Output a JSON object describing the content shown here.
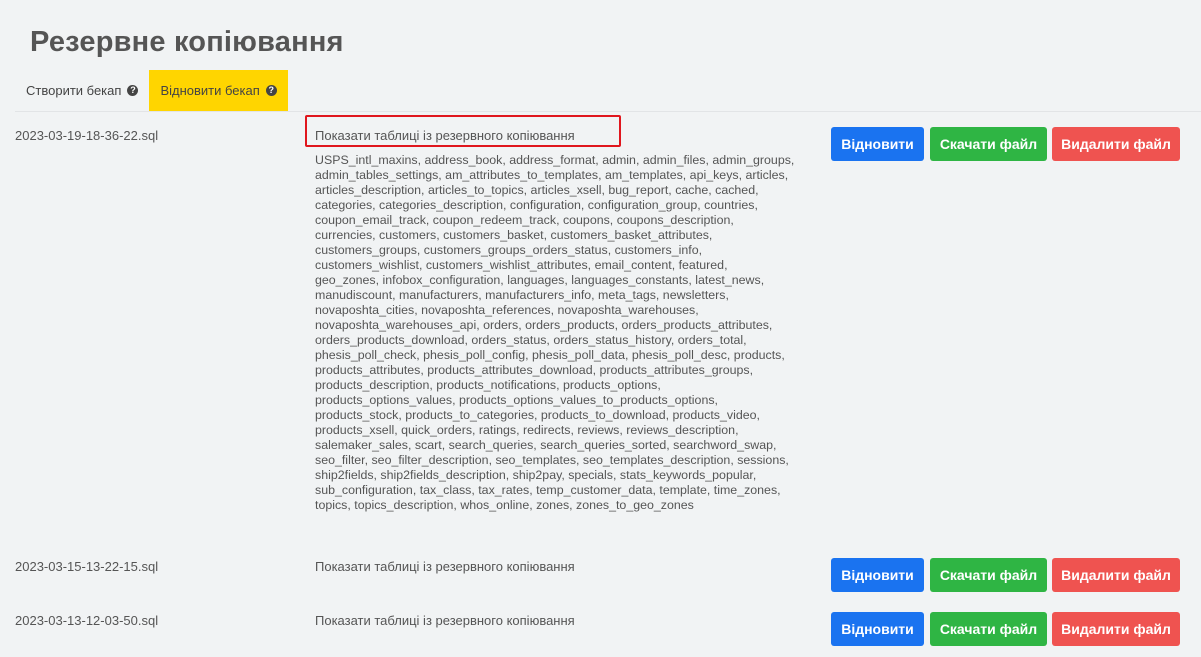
{
  "page": {
    "title": "Резервне копіювання"
  },
  "tabs": [
    {
      "label": "Створити бекап",
      "active": false,
      "icon": "question-circle-icon"
    },
    {
      "label": "Відновити бекап",
      "active": true,
      "icon": "question-circle-icon"
    }
  ],
  "colors": {
    "active_tab": "#ffd500",
    "restore": "#1a73f0",
    "download": "#2fb544",
    "delete": "#ef5350",
    "highlight": "#e0161d"
  },
  "actions": {
    "restore": "Відновити",
    "download": "Скачати файл",
    "delete": "Видалити файл"
  },
  "backups": [
    {
      "filename": "2023-03-19-18-36-22.sql",
      "show_tables": "Показати таблиці із резервного копіювання",
      "tables_expanded": true,
      "tables_text": "USPS_intl_maxins, address_book, address_format, admin, admin_files, admin_groups, admin_tables_settings, am_attributes_to_templates, am_templates, api_keys, articles, articles_description, articles_to_topics, articles_xsell, bug_report, cache, cached, categories, categories_description, configuration, configuration_group, countries, coupon_email_track, coupon_redeem_track, coupons, coupons_description, currencies, customers, customers_basket, customers_basket_attributes, customers_groups, customers_groups_orders_status, customers_info, customers_wishlist, customers_wishlist_attributes, email_content, featured, geo_zones, infobox_configuration, languages, languages_constants, latest_news, manudiscount, manufacturers, manufacturers_info, meta_tags, newsletters, novaposhta_cities, novaposhta_references, novaposhta_warehouses, novaposhta_warehouses_api, orders, orders_products, orders_products_attributes, orders_products_download, orders_status, orders_status_history, orders_total, phesis_poll_check, phesis_poll_config, phesis_poll_data, phesis_poll_desc, products, products_attributes, products_attributes_download, products_attributes_groups, products_description, products_notifications, products_options, products_options_values, products_options_values_to_products_options, products_stock, products_to_categories, products_to_download, products_video, products_xsell, quick_orders, ratings, redirects, reviews, reviews_description, salemaker_sales, scart, search_queries, search_queries_sorted, searchword_swap, seo_filter, seo_filter_description, seo_templates, seo_templates_description, sessions, ship2fields, ship2fields_description, ship2pay, specials, stats_keywords_popular, sub_configuration, tax_class, tax_rates, temp_customer_data, template, time_zones, topics, topics_description, whos_online, zones, zones_to_geo_zones"
    },
    {
      "filename": "2023-03-15-13-22-15.sql",
      "show_tables": "Показати таблиці із резервного копіювання",
      "tables_expanded": false
    },
    {
      "filename": "2023-03-13-12-03-50.sql",
      "show_tables": "Показати таблиці із резервного копіювання",
      "tables_expanded": false
    }
  ]
}
